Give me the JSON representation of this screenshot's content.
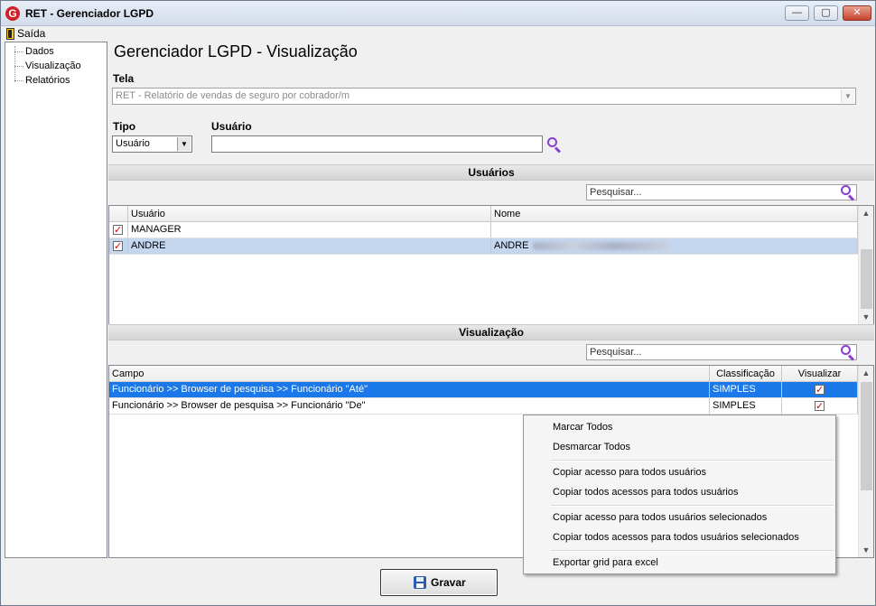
{
  "window": {
    "title": "RET - Gerenciador LGPD",
    "logo_letter": "G",
    "minimize": "—",
    "maximize": "▢",
    "close": "✕"
  },
  "menu": {
    "exit_label": "Saída"
  },
  "tree": {
    "items": [
      "Dados",
      "Visualização",
      "Relatórios"
    ]
  },
  "page": {
    "title": "Gerenciador LGPD - Visualização"
  },
  "form": {
    "tela_label": "Tela",
    "tela_value": "RET - Relatório de vendas de seguro por cobrador/m",
    "tipo_label": "Tipo",
    "tipo_value": "Usuário",
    "usuario_label": "Usuário",
    "usuario_value": ""
  },
  "users_section": {
    "title": "Usuários",
    "search_placeholder": "Pesquisar...",
    "columns": [
      "Usuário",
      "Nome"
    ],
    "rows": [
      {
        "usuario": "MANAGER",
        "nome": "",
        "checked": true
      },
      {
        "usuario": "ANDRE",
        "nome": "ANDRE",
        "checked": true
      }
    ]
  },
  "view_section": {
    "title": "Visualização",
    "search_placeholder": "Pesquisar...",
    "columns": [
      "Campo",
      "Classificação",
      "Visualizar"
    ],
    "rows": [
      {
        "campo": "Funcionário >> Browser de pesquisa >> Funcionário \"Até\"",
        "classificacao": "SIMPLES",
        "visualizar": true
      },
      {
        "campo": "Funcionário >> Browser de pesquisa >> Funcionário \"De\"",
        "classificacao": "SIMPLES",
        "visualizar": true
      }
    ]
  },
  "context_menu": {
    "items": [
      "Marcar Todos",
      "Desmarcar Todos",
      "Copiar acesso para todos usuários",
      "Copiar todos acessos para todos usuários",
      "Copiar acesso para todos usuários selecionados",
      "Copiar todos acessos para todos usuários selecionados",
      "Exportar grid para excel"
    ]
  },
  "actions": {
    "save_label": "Gravar"
  }
}
